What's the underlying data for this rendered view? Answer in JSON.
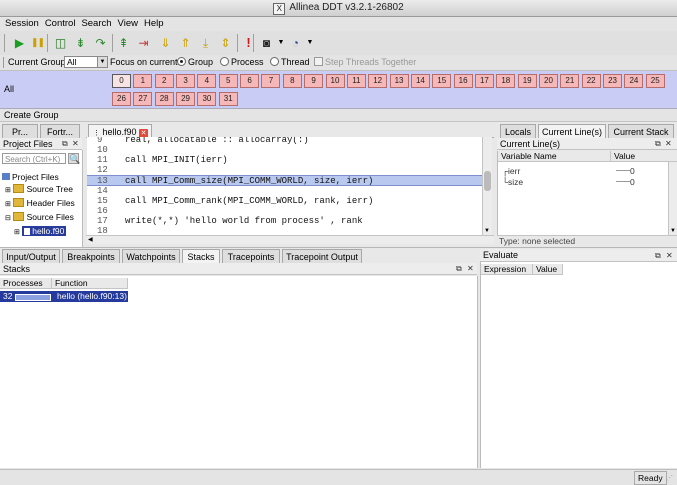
{
  "window": {
    "title": "Allinea DDT v3.2.1-26802"
  },
  "menu": [
    "Session",
    "Control",
    "Search",
    "View",
    "Help"
  ],
  "toolbar_icons": [
    {
      "name": "play-icon",
      "glyph": "▶",
      "color": "#1a9e22"
    },
    {
      "name": "pause-icon",
      "glyph": "❚❚",
      "color": "#c9a100"
    },
    {
      "name": "add-breakpoint-icon",
      "glyph": "◫",
      "color": "#2d7d2d"
    },
    {
      "name": "step-into-icon",
      "glyph": "⇟",
      "color": "#2d8a2d"
    },
    {
      "name": "step-over-icon",
      "glyph": "↷",
      "color": "#2d8a2d"
    },
    {
      "name": "step-out-icon",
      "glyph": "⇞",
      "color": "#2d8a2d"
    },
    {
      "name": "run-to-line-icon",
      "glyph": "⇥",
      "color": "#c83a3a"
    },
    {
      "name": "down-frame-icon",
      "glyph": "⇓",
      "color": "#c9a100"
    },
    {
      "name": "up-frame-icon",
      "glyph": "⇑",
      "color": "#c9a100"
    },
    {
      "name": "bottom-frame-icon",
      "glyph": "⤓",
      "color": "#c9a100"
    },
    {
      "name": "align-stack-icon",
      "glyph": "⇕",
      "color": "#c9a100"
    },
    {
      "name": "alert-icon",
      "glyph": "!",
      "color": "#d01818"
    },
    {
      "name": "camera-icon",
      "glyph": "◙",
      "color": "#222222"
    },
    {
      "name": "gauge-icon",
      "glyph": "◔",
      "color": "#3050a0"
    }
  ],
  "groupbar": {
    "current_group_label": "Current Group:",
    "current_group_value": "All",
    "focus_label": "Focus on current:",
    "radio_group": "Group",
    "radio_process": "Process",
    "radio_thread": "Thread",
    "step_threads": "Step Threads Together"
  },
  "process_group": {
    "label": "All",
    "processes": [
      "0",
      "1",
      "2",
      "3",
      "4",
      "5",
      "6",
      "7",
      "8",
      "9",
      "10",
      "11",
      "12",
      "13",
      "14",
      "15",
      "16",
      "17",
      "18",
      "19",
      "20",
      "21",
      "22",
      "23",
      "24",
      "25",
      "26",
      "27",
      "28",
      "29",
      "30",
      "31"
    ]
  },
  "create_group_label": "Create Group",
  "left_tabs": [
    "Pr...",
    "Fortr..."
  ],
  "project_files": {
    "header": "Project Files",
    "search_placeholder": "Search (Ctrl+K)",
    "tree": [
      {
        "label": "Project Files",
        "level": 0
      },
      {
        "label": "Source Tree",
        "level": 1
      },
      {
        "label": "Header Files",
        "level": 1
      },
      {
        "label": "Source Files",
        "level": 1
      },
      {
        "label": "hello.f90",
        "level": 2
      }
    ]
  },
  "editor": {
    "tab": "hello.f90",
    "lines": [
      {
        "n": "9",
        "text": "real, allocatable :: allocarray(:)"
      },
      {
        "n": "10",
        "text": ""
      },
      {
        "n": "11",
        "text": "call MPI_INIT(ierr)"
      },
      {
        "n": "12",
        "text": ""
      },
      {
        "n": "13",
        "text": "call MPI_Comm_size(MPI_COMM_WORLD, size, ierr)"
      },
      {
        "n": "14",
        "text": ""
      },
      {
        "n": "15",
        "text": "call MPI_Comm_rank(MPI_COMM_WORLD, rank, ierr)"
      },
      {
        "n": "16",
        "text": ""
      },
      {
        "n": "17",
        "text": "write(*,*) 'hello world from process' , rank"
      },
      {
        "n": "18",
        "text": ""
      }
    ],
    "highlighted_line": "13"
  },
  "right_tabs": [
    "Locals",
    "Current Line(s)",
    "Current Stack"
  ],
  "current_lines": {
    "header": "Current Line(s)",
    "columns": [
      "Variable Name",
      "Value"
    ],
    "rows": [
      {
        "name": "ierr",
        "value": "0"
      },
      {
        "name": "size",
        "value": "0"
      }
    ],
    "type_label": "Type: none selected"
  },
  "bottom_tabs": [
    "Input/Output",
    "Breakpoints",
    "Watchpoints",
    "Stacks",
    "Tracepoints",
    "Tracepoint Output"
  ],
  "stacks": {
    "header": "Stacks",
    "columns": [
      "Processes",
      "Function"
    ],
    "rows": [
      {
        "processes": "32",
        "function": "hello (hello.f90:13)"
      }
    ]
  },
  "evaluate": {
    "header": "Evaluate",
    "columns": [
      "Expression",
      "Value"
    ]
  },
  "status": {
    "text": "Ready"
  }
}
